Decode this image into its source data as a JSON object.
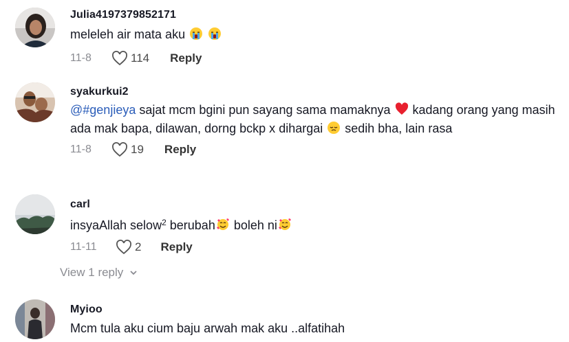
{
  "comments": [
    {
      "username": "Julia4197379852171",
      "text_before": "meleleh air mata aku",
      "date": "11-8",
      "likes": "114",
      "reply_label": "Reply",
      "emojis": [
        "crying-face",
        "crying-face"
      ]
    },
    {
      "username": "syakurkui2",
      "mention": "@#genjieya",
      "text_part1": " sajat mcm bgini pun sayang sama mamaknya ",
      "text_part2": " kadang orang yang masih ada mak bapa, dilawan, dorng bckp x dihargai ",
      "text_part3": " sedih bha, lain rasa",
      "date": "11-8",
      "likes": "19",
      "reply_label": "Reply",
      "emojis": [
        "red-heart",
        "pensive-face"
      ]
    },
    {
      "username": "carl",
      "text_part1": "insyaAllah selow",
      "sup": "2",
      "text_part2": " berubah",
      "text_part3": "  boleh ni",
      "date": "11-11",
      "likes": "2",
      "reply_label": "Reply",
      "emojis": [
        "smiling-face-with-hearts",
        "smiling-face-with-hearts"
      ]
    },
    {
      "username": "Myioo",
      "text_before": "Mcm tula aku cium baju arwah mak aku ..alfatihah"
    }
  ],
  "view_replies_label": "View 1 reply",
  "colors": {
    "mention": "#2b5db9",
    "heart": "#fe2c55",
    "meta": "#8a8b91"
  }
}
